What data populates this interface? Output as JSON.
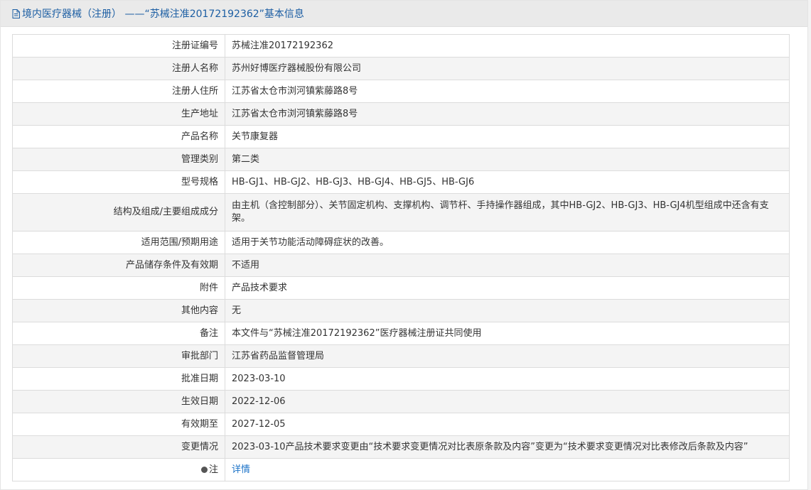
{
  "header": {
    "title": "境内医疗器械（注册） ——“苏械注准20172192362”基本信息"
  },
  "rows": [
    {
      "label": "注册证编号",
      "value": "苏械注准20172192362"
    },
    {
      "label": "注册人名称",
      "value": "苏州好博医疗器械股份有限公司"
    },
    {
      "label": "注册人住所",
      "value": "江苏省太仓市浏河镇紫藤路8号"
    },
    {
      "label": "生产地址",
      "value": "江苏省太仓市浏河镇紫藤路8号"
    },
    {
      "label": "产品名称",
      "value": "关节康复器"
    },
    {
      "label": "管理类别",
      "value": "第二类"
    },
    {
      "label": "型号规格",
      "value": "HB-GJ1、HB-GJ2、HB-GJ3、HB-GJ4、HB-GJ5、HB-GJ6"
    },
    {
      "label": "结构及组成/主要组成成分",
      "value": "由主机（含控制部分）、关节固定机构、支撑机构、调节杆、手持操作器组成，其中HB-GJ2、HB-GJ3、HB-GJ4机型组成中还含有支架。"
    },
    {
      "label": "适用范围/预期用途",
      "value": "适用于关节功能活动障碍症状的改善。"
    },
    {
      "label": "产品储存条件及有效期",
      "value": "不适用"
    },
    {
      "label": "附件",
      "value": "产品技术要求"
    },
    {
      "label": "其他内容",
      "value": "无"
    },
    {
      "label": "备注",
      "value": "本文件与“苏械注准20172192362”医疗器械注册证共同使用"
    },
    {
      "label": "审批部门",
      "value": "江苏省药品监督管理局"
    },
    {
      "label": "批准日期",
      "value": "2023-03-10"
    },
    {
      "label": "生效日期",
      "value": "2022-12-06"
    },
    {
      "label": "有效期至",
      "value": "2027-12-05"
    },
    {
      "label": "变更情况",
      "value": "2023-03-10产品技术要求变更由“技术要求变更情况对比表原条款及内容”变更为“技术要求变更情况对比表修改后条款及内容”"
    }
  ],
  "note": {
    "label": "注",
    "link_text": "详情"
  }
}
